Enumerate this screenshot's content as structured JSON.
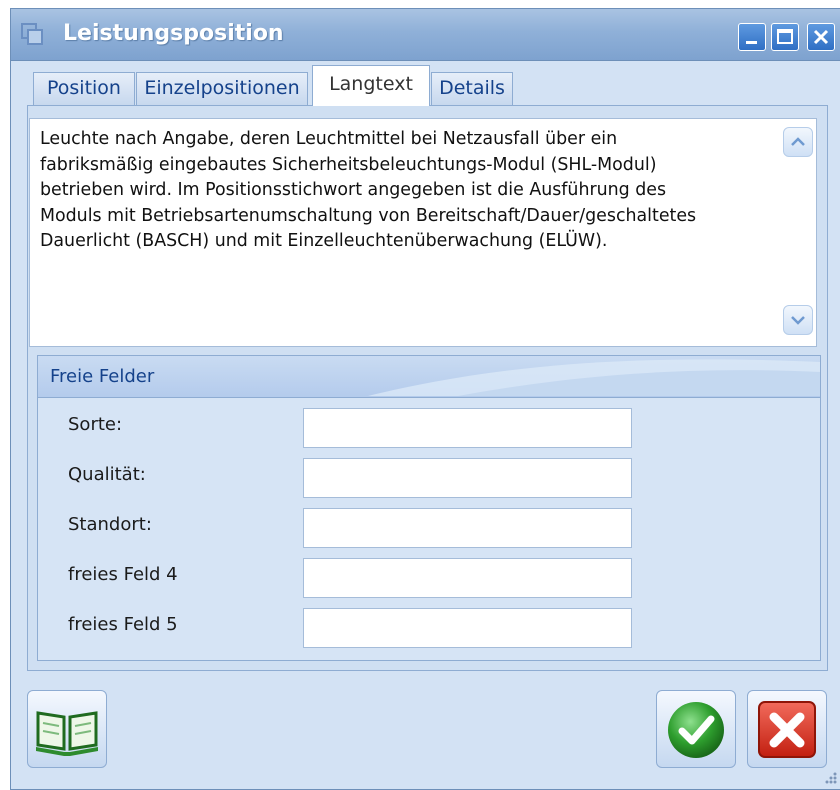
{
  "window": {
    "title": "Leistungsposition",
    "controls": [
      "minimize-icon",
      "maximize-icon",
      "close-icon"
    ]
  },
  "tabs": [
    {
      "label": "Position",
      "active": false
    },
    {
      "label": "Einzelpositionen",
      "active": false
    },
    {
      "label": "Langtext",
      "active": true
    },
    {
      "label": "Details",
      "active": false
    }
  ],
  "longtext": {
    "lines": [
      "Leuchte nach Angabe, deren Leuchtmittel bei Netzausfall über ein",
      "fabriksmäßig eingebautes Sicherheitsbeleuchtungs-Modul (SHL-Modul)",
      "betrieben wird. Im Positionsstichwort angegeben ist die Ausführung des",
      "Moduls mit Betriebsartenumschaltung von Bereitschaft/Dauer/geschaltetes",
      "Dauerlicht (BASCH) und mit Einzelleuchtenüberwachung (ELÜW)."
    ]
  },
  "freie_felder": {
    "title": "Freie Felder",
    "fields": [
      {
        "label": "Sorte:",
        "value": ""
      },
      {
        "label": "Qualität:",
        "value": ""
      },
      {
        "label": "Standort:",
        "value": ""
      },
      {
        "label": "freies Feld 4",
        "value": ""
      },
      {
        "label": "freies Feld 5",
        "value": ""
      }
    ]
  },
  "buttons": {
    "book_icon": "book-icon",
    "ok_icon": "checkmark-icon",
    "cancel_icon": "cross-icon"
  },
  "colors": {
    "titlebar": "#8fb0d8",
    "accent_text": "#15428b",
    "ok_green": "#2e9e2e",
    "cancel_red": "#d42a1a"
  }
}
